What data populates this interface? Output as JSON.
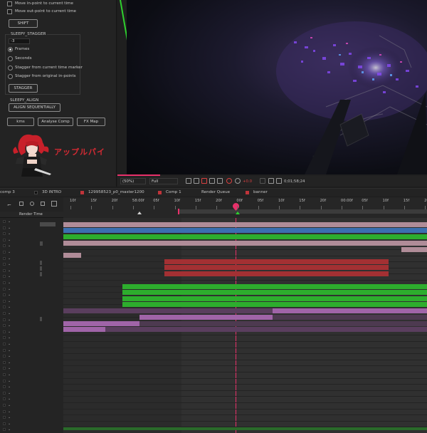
{
  "script_panel": {
    "move_in_point_label": "Move in-point to current time",
    "move_out_point_label": "Move out-point to current time",
    "shift_button": "SHIFT",
    "stagger_section": "SLEEPY_STAGGER",
    "stagger_value": "-3",
    "radio_frames": "Frames",
    "radio_seconds": "Seconds",
    "radio_stagger_marker": "Stagger from current time marker",
    "radio_stagger_inpoints": "Stagger from original in-points",
    "stagger_button": "STAGGER",
    "align_section": "SLEEPY_ALIGN",
    "align_button": "ALIGN SEQUENTIALLY",
    "kms_button": "kms",
    "analyse_button": "Analyse Comp",
    "fxmap_button": "FX Map",
    "logo_text": "アップルパイ"
  },
  "viewer_toolbar": {
    "zoom": "(50%)",
    "resolution": "Full",
    "exposure": "+0.0",
    "timecode": "0;01;58;24"
  },
  "tabs": [
    {
      "label": "comp 3",
      "color": ""
    },
    {
      "label": "3D INTRO",
      "color": "#111111"
    },
    {
      "label": "129958523_p0_master1200",
      "color": "#c0343a"
    },
    {
      "label": "Comp 1",
      "color": "#c0343a"
    },
    {
      "label": "Render Queue",
      "color": ""
    },
    {
      "label": "banner",
      "color": "#c0343a"
    }
  ],
  "timeline": {
    "column_header": "Render Time",
    "ruler_ticks": [
      "10f",
      "15f",
      "20f",
      "58:00f",
      "05f",
      "10f",
      "15f",
      "20f",
      "00f",
      "05f",
      "10f",
      "15f",
      "20f",
      "00:00f",
      "05f",
      "10f",
      "15f",
      "20f"
    ],
    "colors": {
      "pink": "#b08c98",
      "blue": "#3b6fb0",
      "green": "#2dad2d",
      "red": "#a33033",
      "purple": "#a064a8",
      "playhead": "#e8306a"
    }
  }
}
